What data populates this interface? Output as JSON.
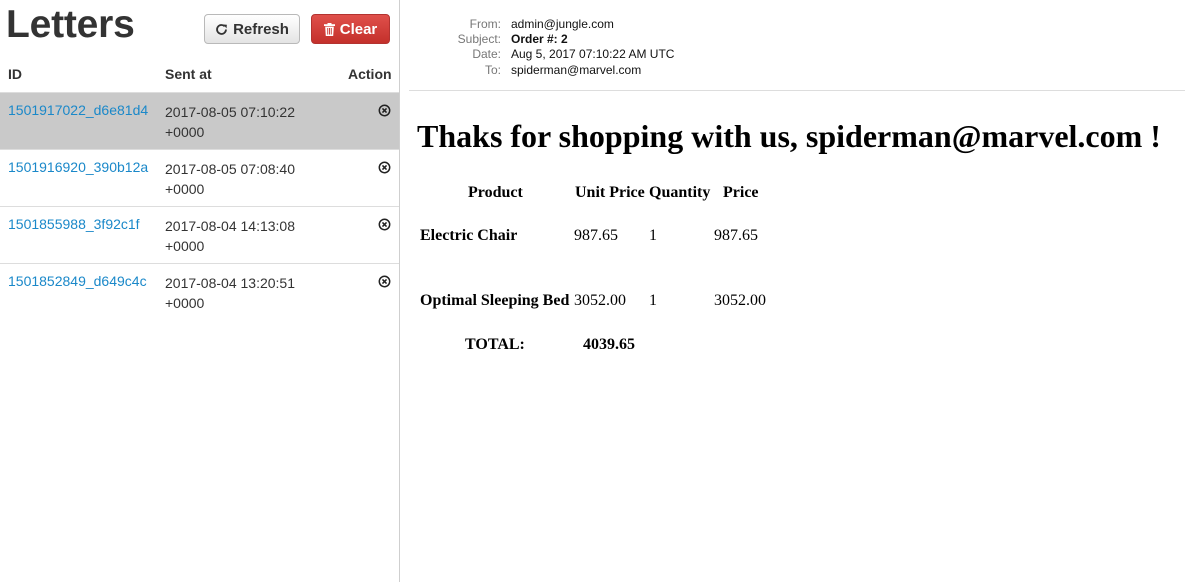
{
  "sidebar": {
    "title": "Letters",
    "refresh_label": "Refresh",
    "clear_label": "Clear",
    "columns": {
      "id": "ID",
      "sent_at": "Sent at",
      "action": "Action"
    },
    "letters": [
      {
        "id": "1501917022_d6e81d4",
        "date": "2017-08-05 07:10:22",
        "tz": "+0000",
        "selected": true
      },
      {
        "id": "1501916920_390b12a",
        "date": "2017-08-05 07:08:40",
        "tz": "+0000",
        "selected": false
      },
      {
        "id": "1501855988_3f92c1f",
        "date": "2017-08-04 14:13:08",
        "tz": "+0000",
        "selected": false
      },
      {
        "id": "1501852849_d649c4c",
        "date": "2017-08-04 13:20:51",
        "tz": "+0000",
        "selected": false
      }
    ]
  },
  "message": {
    "headers": {
      "from_label": "From:",
      "from": "admin@jungle.com",
      "subject_label": "Subject:",
      "subject": "Order #: 2",
      "date_label": "Date:",
      "date": "Aug 5, 2017 07:10:22 AM UTC",
      "to_label": "To:",
      "to": "spiderman@marvel.com"
    },
    "body": {
      "heading": "Thaks for shopping with us, spiderman@marvel.com !",
      "table": {
        "headers": {
          "product": "Product",
          "unit_price": "Unit Price",
          "quantity": "Quantity",
          "price": "Price"
        },
        "rows": [
          {
            "product": "Electric Chair",
            "unit_price": "987.65",
            "quantity": "1",
            "price": "987.65"
          },
          {
            "product": "Optimal Sleeping Bed",
            "unit_price": "3052.00",
            "quantity": "1",
            "price": "3052.00"
          }
        ],
        "total_label": "TOTAL:",
        "total": "4039.65"
      }
    }
  },
  "colors": {
    "link": "#1a88c9",
    "danger": "#d43f3a",
    "selected_row": "#c9c9c9"
  }
}
